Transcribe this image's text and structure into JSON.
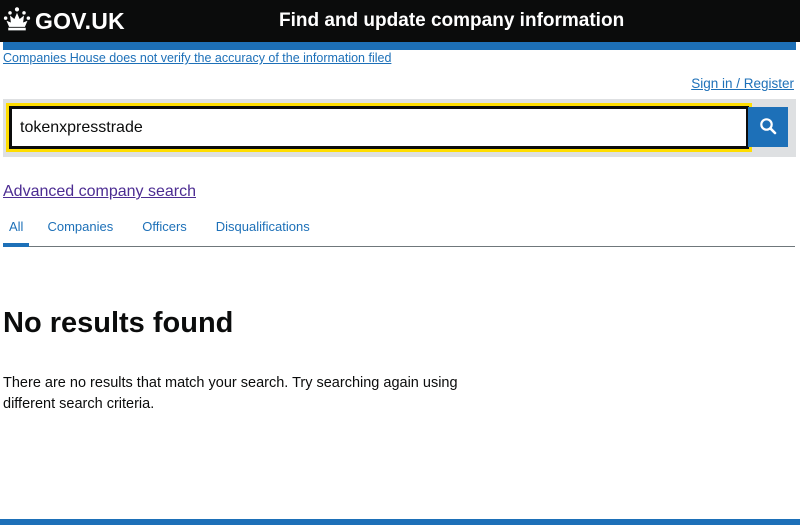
{
  "header": {
    "logo_text": "GOV.UK",
    "service_name": "Find and update company information"
  },
  "disclaimer": "Companies House does not verify the accuracy of the information filed",
  "signin": "Sign in / Register",
  "search": {
    "value": "tokenxpresstrade",
    "button_icon": "search-icon"
  },
  "advanced_search": "Advanced company search",
  "tabs": [
    {
      "label": "All",
      "active": true
    },
    {
      "label": "Companies",
      "active": false
    },
    {
      "label": "Officers",
      "active": false
    },
    {
      "label": "Disqualifications",
      "active": false
    }
  ],
  "results": {
    "title": "No results found",
    "message": "There are no results that match your search. Try searching again using different search criteria."
  },
  "colors": {
    "header_bg": "#0b0c0c",
    "brand_blue": "#1d70b8",
    "focus_yellow": "#ffdd00",
    "visited_link": "#4c2c92",
    "panel_grey": "#dee0e2"
  }
}
